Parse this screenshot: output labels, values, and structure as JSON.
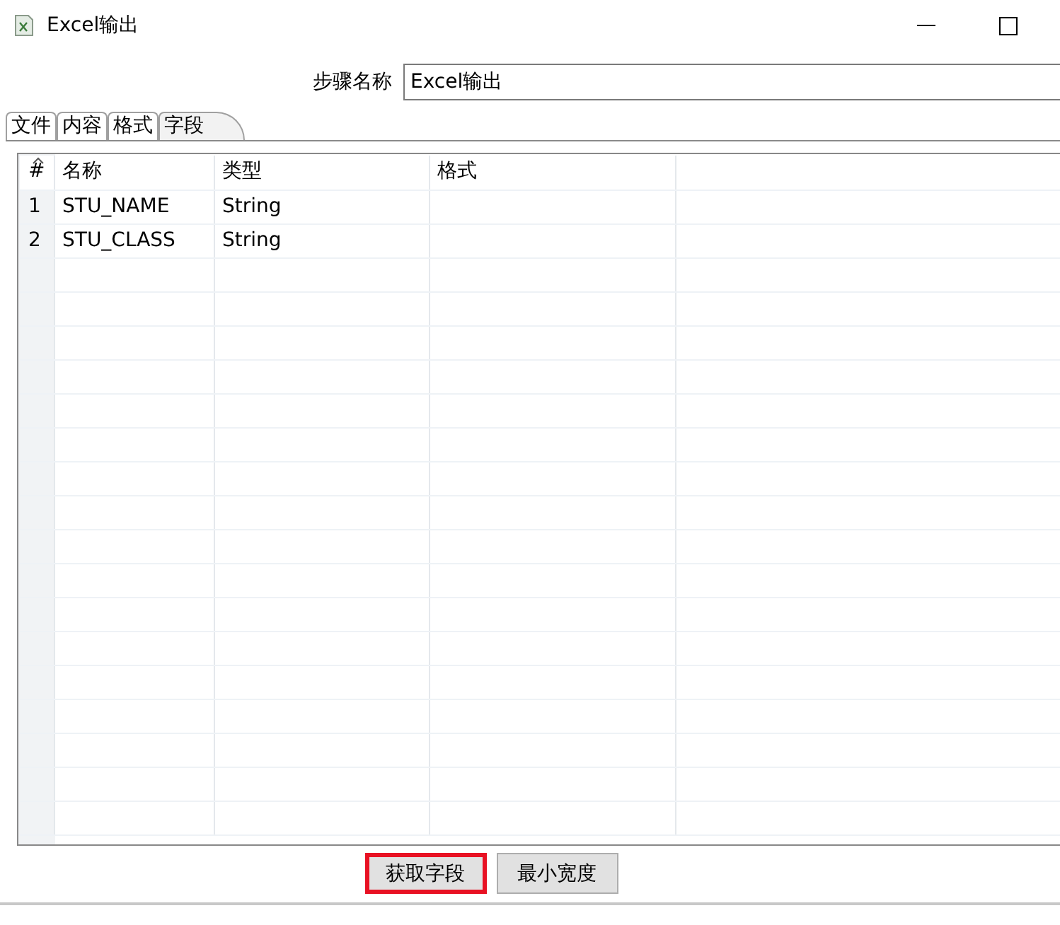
{
  "window": {
    "title": "Excel输出"
  },
  "step_name": {
    "label": "步骤名称",
    "value": "Excel输出"
  },
  "tabs": [
    {
      "label": "文件",
      "selected": false
    },
    {
      "label": "内容",
      "selected": false
    },
    {
      "label": "格式",
      "selected": false
    },
    {
      "label": "字段",
      "selected": true
    }
  ],
  "table": {
    "columns": [
      "#",
      "名称",
      "类型",
      "格式"
    ],
    "rows": [
      [
        "1",
        "STU_NAME",
        "String",
        ""
      ],
      [
        "2",
        "STU_CLASS",
        "String",
        ""
      ]
    ]
  },
  "buttons": [
    {
      "label": "获取字段",
      "highlighted": true
    },
    {
      "label": "最小宽度",
      "highlighted": false
    }
  ]
}
